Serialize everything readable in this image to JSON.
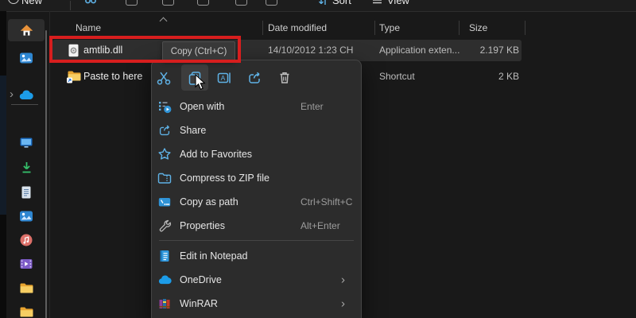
{
  "toolbar": {
    "new_label": "New",
    "sort_label": "Sort",
    "view_label": "View"
  },
  "columns": {
    "name": "Name",
    "date_modified": "Date modified",
    "type": "Type",
    "size": "Size"
  },
  "files": [
    {
      "name": "amtlib.dll",
      "date_modified": "14/10/2012 1:23 CH",
      "type": "Application exten...",
      "size": "2.197 KB",
      "icon": "dll-file-icon",
      "selected": true
    },
    {
      "name": "Paste to here",
      "date_modified": "",
      "type": "Shortcut",
      "size": "2 KB",
      "icon": "shortcut-folder-icon",
      "selected": false
    }
  ],
  "annotation": {
    "type": "red-rectangle",
    "color": "#d71e1e"
  },
  "tooltip": {
    "text": "Copy (Ctrl+C)"
  },
  "context_menu": {
    "quick_actions": [
      "cut-icon",
      "copy-icon",
      "rename-icon",
      "share-icon",
      "delete-icon"
    ],
    "hovered_action": "copy-icon",
    "submenu_glyph": "›",
    "items": [
      {
        "label": "Open with",
        "shortcut": "Enter"
      },
      {
        "label": "Share",
        "shortcut": ""
      },
      {
        "label": "Add to Favorites",
        "shortcut": ""
      },
      {
        "label": "Compress to ZIP file",
        "shortcut": ""
      },
      {
        "label": "Copy as path",
        "shortcut": "Ctrl+Shift+C"
      },
      {
        "label": "Properties",
        "shortcut": "Alt+Enter"
      },
      {
        "label": "Edit in Notepad",
        "shortcut": ""
      },
      {
        "label": "OneDrive",
        "shortcut": "",
        "has_submenu": true
      },
      {
        "label": "WinRAR",
        "shortcut": "",
        "has_submenu": true
      }
    ]
  },
  "sidebar": {
    "expand_glyph": "›",
    "selected": "home-icon",
    "items": [
      "home-icon",
      "gallery-icon",
      "onedrive-icon",
      "desktop-icon",
      "downloads-icon",
      "documents-icon",
      "pictures-icon",
      "music-icon",
      "videos-icon",
      "folder-icon",
      "folder-icon"
    ]
  },
  "colors": {
    "accent_blue": "#5fb2e6",
    "annotation_red": "#d71e1e",
    "menu_bg": "#2c2c2c",
    "row_highlight": "#2e2e2e",
    "folder_yellow": "#f2c14d",
    "onedrive_blue": "#1c9ce8"
  }
}
